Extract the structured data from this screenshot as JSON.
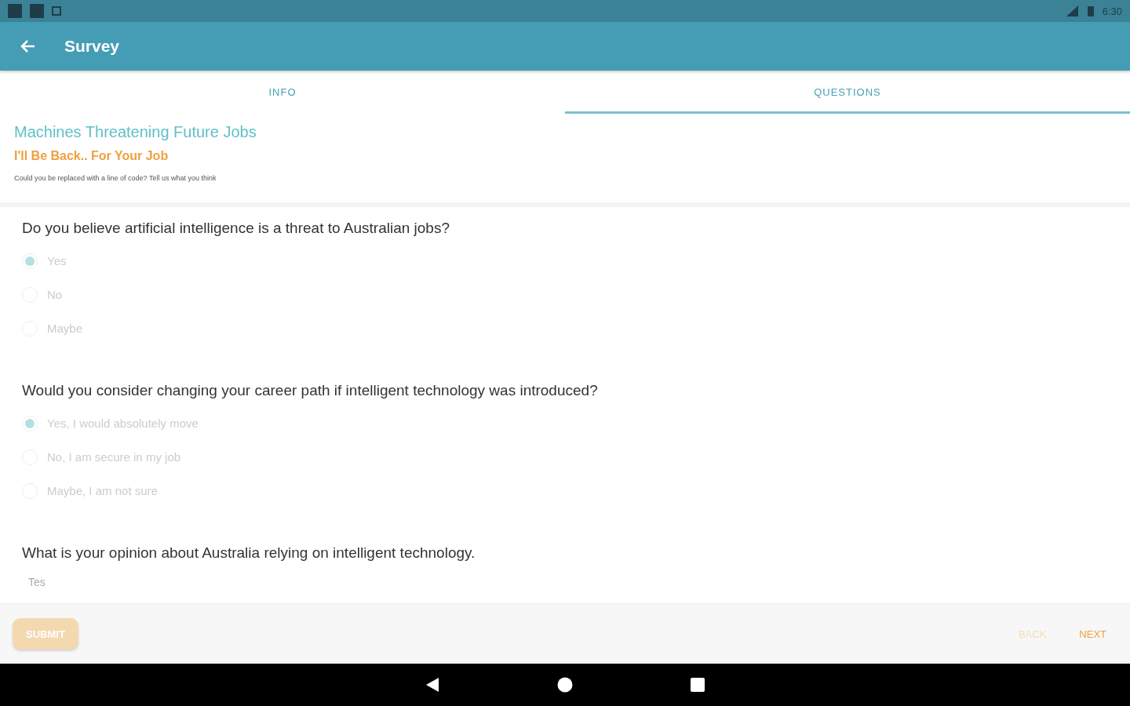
{
  "status_bar": {
    "time": "6:30"
  },
  "app_bar": {
    "title": "Survey"
  },
  "tabs": [
    {
      "label": "INFO",
      "selected": false
    },
    {
      "label": "QUESTIONS",
      "selected": true
    }
  ],
  "survey": {
    "title": "Machines Threatening Future Jobs",
    "subtitle": "I'll Be Back.. For Your Job",
    "description": "Could you be replaced with a line of code? Tell us what you think"
  },
  "questions": [
    {
      "kind": "choice",
      "text": "Do you believe artificial intelligence is a threat to Australian jobs?",
      "options": [
        {
          "label": "Yes",
          "selected": true,
          "disabled": true
        },
        {
          "label": "No",
          "selected": false,
          "disabled": true
        },
        {
          "label": "Maybe",
          "selected": false,
          "disabled": true
        }
      ]
    },
    {
      "kind": "choice",
      "text": "Would you consider changing your career path if intelligent technology was introduced?",
      "options": [
        {
          "label": "Yes, I would absolutely move",
          "selected": true,
          "disabled": true
        },
        {
          "label": "No, I am secure in my job",
          "selected": false,
          "disabled": true
        },
        {
          "label": "Maybe, I am not sure",
          "selected": false,
          "disabled": true
        }
      ]
    },
    {
      "kind": "text",
      "text": "What is your opinion about Australia relying on intelligent technology.",
      "value": "Tes"
    }
  ],
  "footer": {
    "submit": {
      "label": "SUBMIT",
      "disabled": true
    },
    "back": {
      "label": "BACK",
      "disabled": true
    },
    "next": {
      "label": "NEXT",
      "disabled": false
    }
  }
}
